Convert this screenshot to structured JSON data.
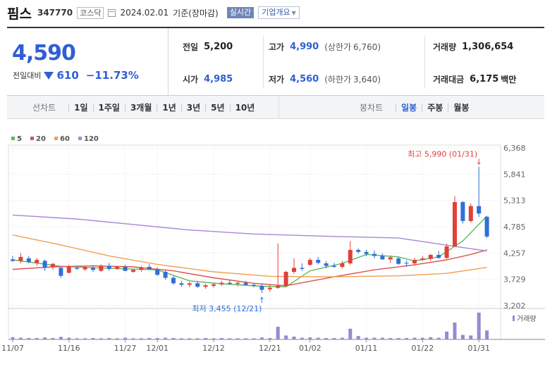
{
  "stock": {
    "name": "핌스",
    "code": "347770",
    "market": "코스닥",
    "date": "2024.02.01",
    "basis": "기준(장마감)",
    "btn_realtime": "실시간",
    "btn_company": "기업개요"
  },
  "quote": {
    "price": "4,590",
    "change_label": "전일대비",
    "change": "610",
    "change_pct": "−11.73%",
    "prev_label": "전일",
    "prev": "5,200",
    "high_label": "고가",
    "high": "4,990",
    "upper_label": "(상한가",
    "upper": "6,760)",
    "volume_label": "거래량",
    "volume": "1,306,654",
    "open_label": "시가",
    "open": "4,985",
    "low_label": "저가",
    "low": "4,560",
    "lower_label": "(하한가",
    "lower": "3,640)",
    "amount_label": "거래대금",
    "amount": "6,175",
    "amount_unit": "백만"
  },
  "periods": {
    "label": "선차트",
    "items": [
      "1일",
      "1주일",
      "3개월",
      "1년",
      "3년",
      "5년",
      "10년"
    ],
    "candle_label": "봉차트",
    "candle_items": [
      "일봉",
      "주봉",
      "월봉"
    ],
    "candle_active": 0
  },
  "chart_data": {
    "type": "candlestick",
    "legend": [
      {
        "name": "5",
        "color": "#5cb85c"
      },
      {
        "name": "20",
        "color": "#d9534f"
      },
      {
        "name": "60",
        "color": "#f0a050"
      },
      {
        "name": "120",
        "color": "#a986d6"
      }
    ],
    "ylim": [
      3202,
      6368
    ],
    "yticks": [
      "6,368",
      "5,841",
      "5,313",
      "4,785",
      "4,257",
      "3,729",
      "3,202"
    ],
    "xticks": [
      {
        "i": 0,
        "label": "11/07"
      },
      {
        "i": 7,
        "label": "11/16"
      },
      {
        "i": 14,
        "label": "11/27"
      },
      {
        "i": 18,
        "label": "12/01"
      },
      {
        "i": 25,
        "label": "12/12"
      },
      {
        "i": 32,
        "label": "12/21"
      },
      {
        "i": 37,
        "label": "01/02"
      },
      {
        "i": 44,
        "label": "01/11"
      },
      {
        "i": 51,
        "label": "01/22"
      },
      {
        "i": 58,
        "label": "01/31"
      }
    ],
    "candles": [
      [
        4130,
        4200,
        4080,
        4100
      ],
      [
        4100,
        4260,
        4050,
        4180
      ],
      [
        4150,
        4200,
        4050,
        4080
      ],
      [
        4060,
        4160,
        4000,
        4120
      ],
      [
        4100,
        4130,
        3900,
        3960
      ],
      [
        3980,
        4060,
        3920,
        4040
      ],
      [
        3960,
        3990,
        3760,
        3800
      ],
      [
        3860,
        4020,
        3850,
        3990
      ],
      [
        3960,
        4000,
        3920,
        3940
      ],
      [
        3930,
        3990,
        3900,
        3970
      ],
      [
        3960,
        4000,
        3880,
        3920
      ],
      [
        3900,
        4030,
        3880,
        4000
      ],
      [
        4000,
        4060,
        3900,
        3940
      ],
      [
        3940,
        4000,
        3920,
        3980
      ],
      [
        3980,
        4020,
        3890,
        3900
      ],
      [
        3880,
        3940,
        3860,
        3920
      ],
      [
        3920,
        4000,
        3880,
        3970
      ],
      [
        3980,
        4040,
        3920,
        3930
      ],
      [
        3930,
        3970,
        3800,
        3820
      ],
      [
        3880,
        3920,
        3720,
        3760
      ],
      [
        3760,
        3800,
        3620,
        3650
      ],
      [
        3650,
        3700,
        3580,
        3620
      ],
      [
        3620,
        3680,
        3570,
        3650
      ],
      [
        3650,
        3700,
        3560,
        3580
      ],
      [
        3580,
        3640,
        3540,
        3610
      ],
      [
        3600,
        3650,
        3560,
        3630
      ],
      [
        3630,
        3700,
        3600,
        3660
      ],
      [
        3660,
        3710,
        3620,
        3640
      ],
      [
        3640,
        3680,
        3590,
        3660
      ],
      [
        3660,
        3700,
        3600,
        3620
      ],
      [
        3620,
        3660,
        3570,
        3600
      ],
      [
        3600,
        3640,
        3455,
        3520
      ],
      [
        3530,
        3620,
        3480,
        3560
      ],
      [
        3560,
        4450,
        3540,
        3600
      ],
      [
        3600,
        3900,
        3580,
        3880
      ],
      [
        3880,
        4150,
        3840,
        3960
      ],
      [
        3960,
        4050,
        3900,
        3940
      ],
      [
        4020,
        4160,
        4000,
        4120
      ],
      [
        4120,
        4180,
        4030,
        4060
      ],
      [
        4050,
        4100,
        3950,
        4000
      ],
      [
        4000,
        4060,
        3960,
        3980
      ],
      [
        3980,
        4100,
        3950,
        4050
      ],
      [
        4050,
        4500,
        4020,
        4320
      ],
      [
        4320,
        4350,
        4250,
        4280
      ],
      [
        4280,
        4320,
        4190,
        4240
      ],
      [
        4240,
        4310,
        4150,
        4200
      ],
      [
        4200,
        4250,
        4120,
        4130
      ],
      [
        4130,
        4210,
        4060,
        4170
      ],
      [
        4150,
        4180,
        4020,
        4040
      ],
      [
        4060,
        4110,
        3980,
        4050
      ],
      [
        4050,
        4160,
        4000,
        4120
      ],
      [
        4120,
        4200,
        4100,
        4150
      ],
      [
        4140,
        4240,
        4100,
        4220
      ],
      [
        4220,
        4300,
        4140,
        4160
      ],
      [
        4160,
        4440,
        4140,
        4390
      ],
      [
        4390,
        5400,
        4380,
        5280
      ],
      [
        5280,
        5300,
        4850,
        4900
      ],
      [
        4900,
        5250,
        4870,
        5200
      ],
      [
        5200,
        5990,
        4980,
        5050
      ],
      [
        4985,
        4990,
        4560,
        4590
      ]
    ],
    "ma": {
      "5": [
        [
          0,
          4120
        ],
        [
          6,
          3990
        ],
        [
          12,
          3950
        ],
        [
          18,
          3920
        ],
        [
          22,
          3700
        ],
        [
          26,
          3640
        ],
        [
          31,
          3590
        ],
        [
          34,
          3580
        ],
        [
          37,
          3900
        ],
        [
          41,
          4050
        ],
        [
          44,
          4230
        ],
        [
          48,
          4180
        ],
        [
          50,
          4100
        ],
        [
          53,
          4180
        ],
        [
          56,
          4500
        ],
        [
          59,
          5000
        ]
      ],
      "20": [
        [
          0,
          3930
        ],
        [
          5,
          3980
        ],
        [
          10,
          4000
        ],
        [
          15,
          3980
        ],
        [
          20,
          3900
        ],
        [
          25,
          3760
        ],
        [
          30,
          3650
        ],
        [
          34,
          3600
        ],
        [
          40,
          3780
        ],
        [
          45,
          3920
        ],
        [
          50,
          4020
        ],
        [
          54,
          4120
        ],
        [
          57,
          4230
        ],
        [
          59,
          4320
        ]
      ],
      "60": [
        [
          0,
          4620
        ],
        [
          6,
          4420
        ],
        [
          12,
          4200
        ],
        [
          18,
          4030
        ],
        [
          25,
          3880
        ],
        [
          32,
          3790
        ],
        [
          40,
          3780
        ],
        [
          48,
          3800
        ],
        [
          54,
          3850
        ],
        [
          59,
          3970
        ]
      ],
      "120": [
        [
          0,
          5020
        ],
        [
          8,
          4940
        ],
        [
          15,
          4830
        ],
        [
          22,
          4720
        ],
        [
          30,
          4640
        ],
        [
          40,
          4590
        ],
        [
          48,
          4560
        ],
        [
          55,
          4390
        ],
        [
          59,
          4300
        ]
      ]
    },
    "volumes": [
      8,
      6,
      5,
      5,
      7,
      5,
      9,
      6,
      4,
      4,
      5,
      4,
      5,
      4,
      6,
      4,
      4,
      5,
      5,
      6,
      5,
      4,
      4,
      4,
      5,
      4,
      5,
      4,
      4,
      4,
      4,
      7,
      5,
      45,
      14,
      10,
      6,
      7,
      6,
      5,
      5,
      6,
      38,
      12,
      6,
      6,
      6,
      5,
      5,
      5,
      6,
      6,
      8,
      6,
      28,
      60,
      16,
      14,
      95,
      32
    ],
    "volume_label": "거래량",
    "max_label": "최고 5,990 (01/31)",
    "max_index": 58,
    "min_label": "최저 3,455 (12/21)",
    "min_index": 31
  },
  "colors": {
    "up": "#e0403a",
    "down": "#2f6fd8",
    "volume": "#9a88d0",
    "accent": "#2f5fd3"
  }
}
